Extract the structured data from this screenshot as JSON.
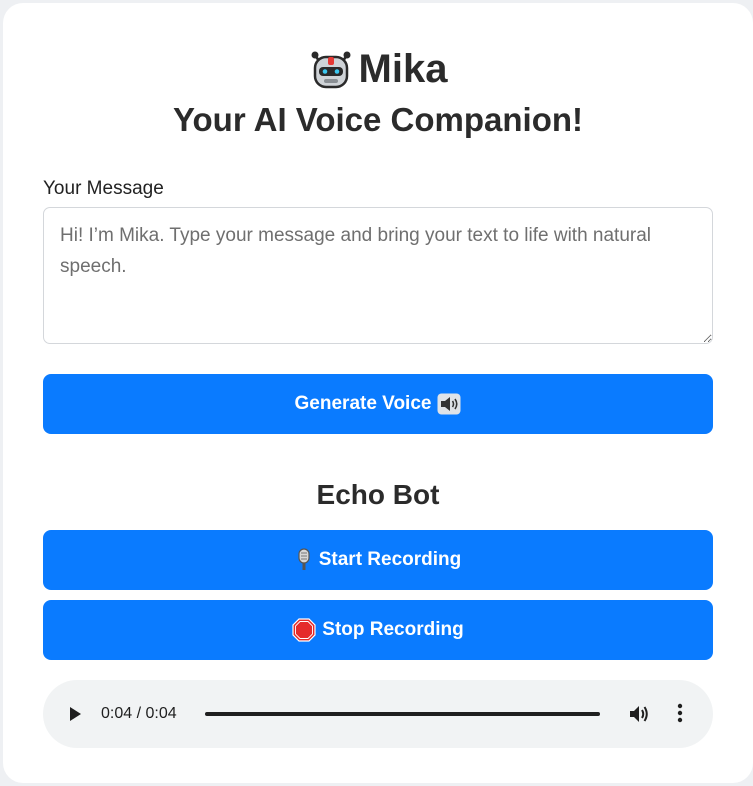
{
  "header": {
    "app_name": "Mika",
    "tagline": "Your AI Voice Companion!",
    "logo_icon": "robot-icon"
  },
  "message": {
    "label": "Your Message",
    "placeholder": "Hi! I’m Mika. Type your message and bring your text to life with natural speech.",
    "value": ""
  },
  "generate_button": {
    "label": "Generate Voice",
    "icon": "speaker-icon"
  },
  "echo_bot": {
    "title": "Echo Bot",
    "start_label": "Start Recording",
    "start_icon": "microphone-icon",
    "stop_label": "Stop Recording",
    "stop_icon": "stop-sign-icon"
  },
  "audio_player": {
    "time_display": "0:04 / 0:04",
    "progress": 1.0
  },
  "colors": {
    "primary": "#0a7bff",
    "player_bg": "#f1f3f4",
    "card_bg": "#ffffff",
    "page_bg": "#eef0f3"
  }
}
